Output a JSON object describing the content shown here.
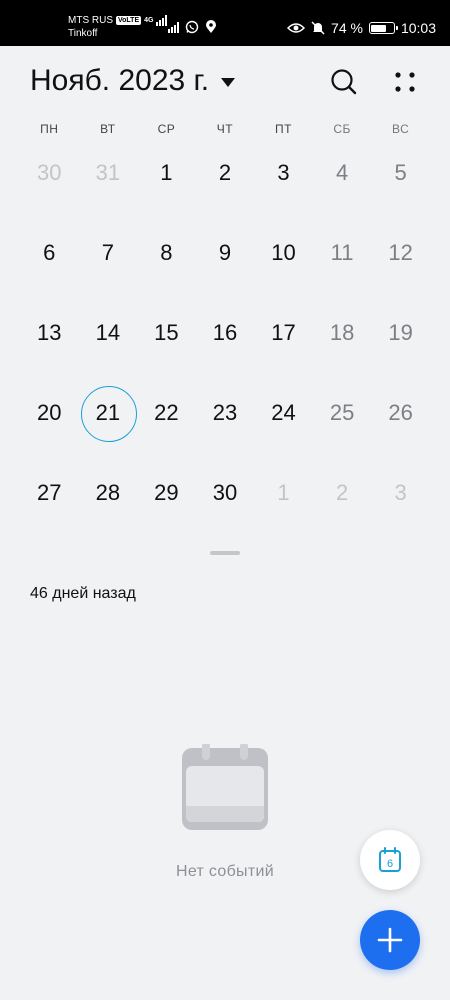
{
  "status_bar": {
    "carrier_primary": "MTS RUS",
    "volte_badge": "VoLTE",
    "network_type": "4G",
    "carrier_secondary": "Tinkoff",
    "battery_percent": 74,
    "battery_text": "74 %",
    "time": "10:03",
    "icons": [
      "signal-icon",
      "signal-icon",
      "whatsapp-icon",
      "location-icon",
      "eye-icon",
      "mute-icon",
      "battery-icon"
    ]
  },
  "header": {
    "month_title": "Нояб. 2023 г.",
    "search_icon": "search-icon",
    "more_icon": "more-dots-icon"
  },
  "weekdays": [
    "ПН",
    "ВТ",
    "СР",
    "ЧТ",
    "ПТ",
    "СБ",
    "ВС"
  ],
  "weeks": [
    [
      {
        "d": "30",
        "s": "other"
      },
      {
        "d": "31",
        "s": "other"
      },
      {
        "d": "1",
        "s": ""
      },
      {
        "d": "2",
        "s": ""
      },
      {
        "d": "3",
        "s": ""
      },
      {
        "d": "4",
        "s": "weekend"
      },
      {
        "d": "5",
        "s": "weekend"
      }
    ],
    [
      {
        "d": "6",
        "s": ""
      },
      {
        "d": "7",
        "s": ""
      },
      {
        "d": "8",
        "s": ""
      },
      {
        "d": "9",
        "s": ""
      },
      {
        "d": "10",
        "s": ""
      },
      {
        "d": "11",
        "s": "weekend"
      },
      {
        "d": "12",
        "s": "weekend"
      }
    ],
    [
      {
        "d": "13",
        "s": ""
      },
      {
        "d": "14",
        "s": ""
      },
      {
        "d": "15",
        "s": ""
      },
      {
        "d": "16",
        "s": ""
      },
      {
        "d": "17",
        "s": ""
      },
      {
        "d": "18",
        "s": "weekend"
      },
      {
        "d": "19",
        "s": "weekend"
      }
    ],
    [
      {
        "d": "20",
        "s": ""
      },
      {
        "d": "21",
        "s": "today"
      },
      {
        "d": "22",
        "s": ""
      },
      {
        "d": "23",
        "s": ""
      },
      {
        "d": "24",
        "s": ""
      },
      {
        "d": "25",
        "s": "weekend"
      },
      {
        "d": "26",
        "s": "weekend"
      }
    ],
    [
      {
        "d": "27",
        "s": ""
      },
      {
        "d": "28",
        "s": ""
      },
      {
        "d": "29",
        "s": ""
      },
      {
        "d": "30",
        "s": ""
      },
      {
        "d": "1",
        "s": "other"
      },
      {
        "d": "2",
        "s": "other"
      },
      {
        "d": "3",
        "s": "other"
      }
    ]
  ],
  "selected_info": "46 дней назад",
  "empty_state": {
    "icon": "calendar-empty-icon",
    "text": "Нет событий"
  },
  "fabs": {
    "today_number": "6",
    "today_icon": "today-calendar-icon",
    "add_icon": "plus-icon"
  },
  "colors": {
    "accent": "#1e6ef0",
    "today_ring": "#1aa0d8",
    "background": "#f1f2f4"
  }
}
